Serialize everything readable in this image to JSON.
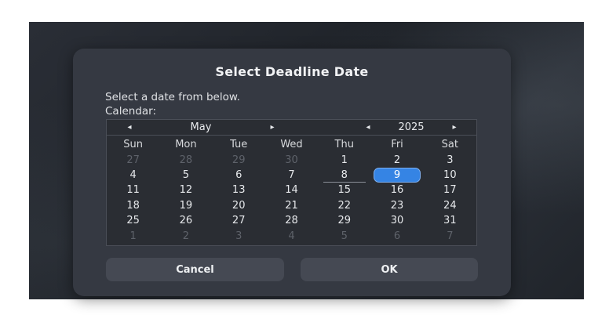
{
  "dialog": {
    "title": "Select Deadline Date",
    "subtitle": "Select a date from below.",
    "calendar_label": "Calendar:"
  },
  "calendar": {
    "month": "May",
    "year": "2025",
    "prev_month": "◂",
    "next_month": "▸",
    "prev_year": "◂",
    "next_year": "▸",
    "weekdays": [
      "Sun",
      "Mon",
      "Tue",
      "Wed",
      "Thu",
      "Fri",
      "Sat"
    ],
    "weeks": [
      [
        "27",
        "28",
        "29",
        "30",
        "1",
        "2",
        "3"
      ],
      [
        "4",
        "5",
        "6",
        "7",
        "8",
        "9",
        "10"
      ],
      [
        "11",
        "12",
        "13",
        "14",
        "15",
        "16",
        "17"
      ],
      [
        "18",
        "19",
        "20",
        "21",
        "22",
        "23",
        "24"
      ],
      [
        "25",
        "26",
        "27",
        "28",
        "29",
        "30",
        "31"
      ],
      [
        "1",
        "2",
        "3",
        "4",
        "5",
        "6",
        "7"
      ]
    ],
    "selected_day": "9",
    "today_day": "8"
  },
  "buttons": {
    "cancel": "Cancel",
    "ok": "OK"
  },
  "colors": {
    "dialog_bg": "#353942",
    "selected": "#3584e4",
    "dim_text": "#5e626a"
  }
}
